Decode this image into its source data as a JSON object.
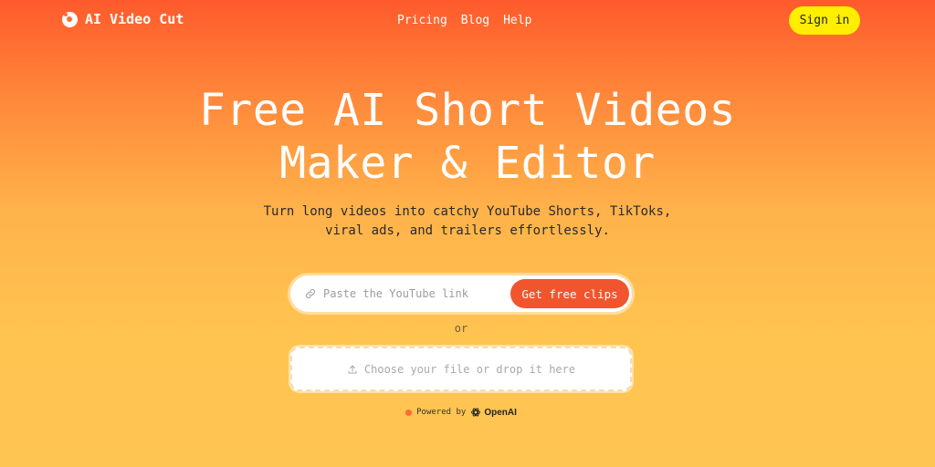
{
  "nav": {
    "brand": "AI Video Cut",
    "links": [
      "Pricing",
      "Blog",
      "Help"
    ],
    "signin": "Sign in"
  },
  "hero": {
    "title_line1": "Free AI Short Videos",
    "title_line2": "Maker & Editor",
    "subtitle_line1": "Turn long videos into catchy YouTube Shorts, TikToks,",
    "subtitle_line2": "viral ads, and trailers effortlessly."
  },
  "url_form": {
    "placeholder": "Paste the YouTube link",
    "value": "",
    "button": "Get free clips"
  },
  "separator": "or",
  "upload": {
    "label": "Choose your file or drop it here"
  },
  "footer": {
    "powered_by": "Powered by",
    "provider": "OpenAI"
  },
  "colors": {
    "accent": "#f2552e",
    "signin_bg": "#ffee00",
    "gradient_top": "#ff5a2c",
    "gradient_bottom": "#ffc552"
  },
  "icons": [
    "logo-icon",
    "link-icon",
    "upload-icon",
    "openai-icon"
  ]
}
